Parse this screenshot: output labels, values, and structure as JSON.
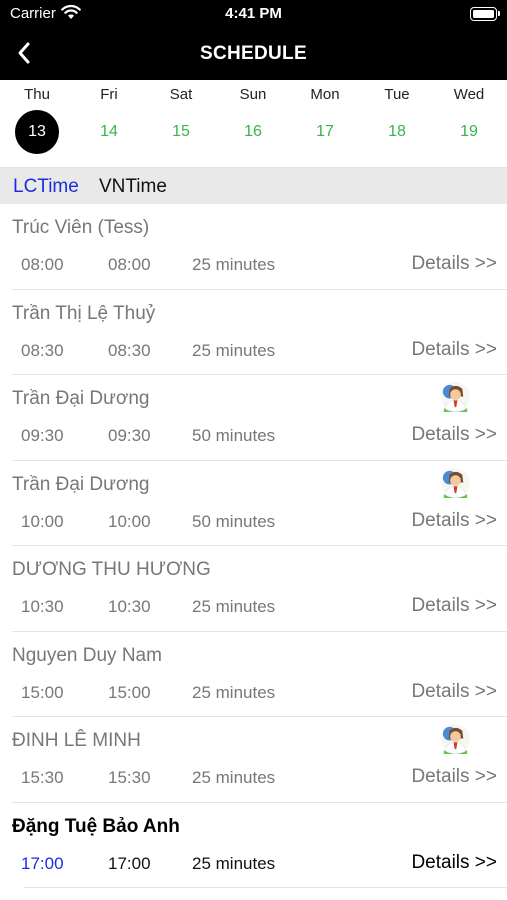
{
  "status_bar": {
    "carrier": "Carrier",
    "time": "4:41 PM"
  },
  "nav": {
    "title": "SCHEDULE",
    "back_icon": "chevron-left-icon"
  },
  "week": [
    {
      "day": "Thu",
      "date": "13",
      "selected": true
    },
    {
      "day": "Fri",
      "date": "14",
      "selected": false
    },
    {
      "day": "Sat",
      "date": "15",
      "selected": false
    },
    {
      "day": "Sun",
      "date": "16",
      "selected": false
    },
    {
      "day": "Mon",
      "date": "17",
      "selected": false
    },
    {
      "day": "Tue",
      "date": "18",
      "selected": false
    },
    {
      "day": "Wed",
      "date": "19",
      "selected": false
    }
  ],
  "timezones": {
    "lc": "LCTime",
    "vn": "VNTime"
  },
  "details_label": "Details >>",
  "schedule": [
    {
      "name": "Trúc Viên (Tess)",
      "lc_time": "08:00",
      "vn_time": "08:00",
      "duration": "25 minutes",
      "details": "Details >>",
      "has_avatar": false,
      "active": false
    },
    {
      "name": "Trần Thị Lệ Thuỷ",
      "lc_time": "08:30",
      "vn_time": "08:30",
      "duration": "25 minutes",
      "details": "Details >>",
      "has_avatar": false,
      "active": false
    },
    {
      "name": "Trần Đại Dương",
      "lc_time": "09:30",
      "vn_time": "09:30",
      "duration": "50 minutes",
      "details": "Details >>",
      "has_avatar": true,
      "active": false
    },
    {
      "name": "Trần Đại Dương",
      "lc_time": "10:00",
      "vn_time": "10:00",
      "duration": "50 minutes",
      "details": "Details >>",
      "has_avatar": true,
      "active": false
    },
    {
      "name": "DƯƠNG THU HƯƠNG",
      "lc_time": "10:30",
      "vn_time": "10:30",
      "duration": "25 minutes",
      "details": "Details >>",
      "has_avatar": false,
      "active": false
    },
    {
      "name": "Nguyen Duy Nam",
      "lc_time": "15:00",
      "vn_time": "15:00",
      "duration": "25 minutes",
      "details": "Details >>",
      "has_avatar": false,
      "active": false
    },
    {
      "name": "ĐINH LÊ MINH",
      "lc_time": "15:30",
      "vn_time": "15:30",
      "duration": "25 minutes",
      "details": "Details >>",
      "has_avatar": true,
      "active": false
    },
    {
      "name": "Đặng Tuệ Bảo Anh",
      "lc_time": "17:00",
      "vn_time": "17:00",
      "duration": "25 minutes",
      "details": "Details >>",
      "has_avatar": false,
      "active": true
    }
  ],
  "colors": {
    "header_bg": "#000000",
    "date_green": "#39b54a",
    "lc_blue": "#1a2ee0",
    "tz_bar_bg": "#e9e9e9",
    "muted_text": "#777777"
  }
}
